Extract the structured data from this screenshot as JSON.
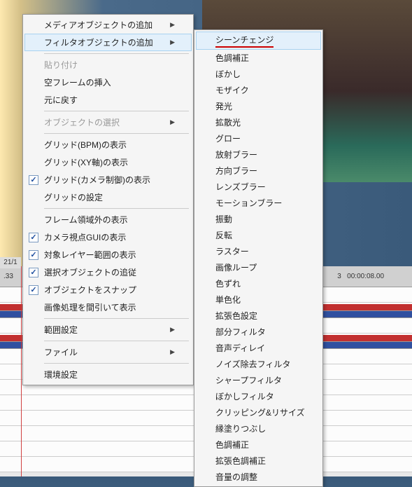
{
  "timeline": {
    "label_cell": "21/1",
    "timecode_left": ".33",
    "timecode_right_1": "3",
    "timecode_right_2": "00:00:08.00"
  },
  "menu": {
    "items": [
      {
        "label": "メディアオブジェクトの追加",
        "submenu": true,
        "disabled": false
      },
      {
        "label": "フィルタオブジェクトの追加",
        "submenu": true,
        "disabled": false,
        "highlighted": true
      },
      {
        "type": "separator"
      },
      {
        "label": "貼り付け",
        "disabled": true
      },
      {
        "label": "空フレームの挿入",
        "disabled": false
      },
      {
        "label": "元に戻す",
        "disabled": false
      },
      {
        "type": "separator"
      },
      {
        "label": "オブジェクトの選択",
        "submenu": true,
        "disabled": true
      },
      {
        "type": "separator"
      },
      {
        "label": "グリッド(BPM)の表示",
        "disabled": false
      },
      {
        "label": "グリッド(XY軸)の表示",
        "disabled": false
      },
      {
        "label": "グリッド(カメラ制御)の表示",
        "disabled": false,
        "checked": true
      },
      {
        "label": "グリッドの設定",
        "disabled": false
      },
      {
        "type": "separator"
      },
      {
        "label": "フレーム領域外の表示",
        "disabled": false
      },
      {
        "label": "カメラ視点GUIの表示",
        "disabled": false,
        "checked": true
      },
      {
        "label": "対象レイヤー範囲の表示",
        "disabled": false,
        "checked": true
      },
      {
        "label": "選択オブジェクトの追従",
        "disabled": false,
        "checked": true
      },
      {
        "label": "オブジェクトをスナップ",
        "disabled": false,
        "checked": true
      },
      {
        "label": "画像処理を間引いて表示",
        "disabled": false
      },
      {
        "type": "separator"
      },
      {
        "label": "範囲設定",
        "submenu": true,
        "disabled": false
      },
      {
        "type": "separator"
      },
      {
        "label": "ファイル",
        "submenu": true,
        "disabled": false
      },
      {
        "type": "separator"
      },
      {
        "label": "環境設定",
        "disabled": false
      }
    ]
  },
  "submenu": {
    "items": [
      {
        "label": "シーンチェンジ",
        "highlighted": true,
        "underlined": true
      },
      {
        "label": "色調補正"
      },
      {
        "label": "ぼかし"
      },
      {
        "label": "モザイク"
      },
      {
        "label": "発光"
      },
      {
        "label": "拡散光"
      },
      {
        "label": "グロー"
      },
      {
        "label": "放射ブラー"
      },
      {
        "label": "方向ブラー"
      },
      {
        "label": "レンズブラー"
      },
      {
        "label": "モーションブラー"
      },
      {
        "label": "振動"
      },
      {
        "label": "反転"
      },
      {
        "label": "ラスター"
      },
      {
        "label": "画像ループ"
      },
      {
        "label": "色ずれ"
      },
      {
        "label": "単色化"
      },
      {
        "label": "拡張色設定"
      },
      {
        "label": "部分フィルタ"
      },
      {
        "label": "音声ディレイ"
      },
      {
        "label": "ノイズ除去フィルタ"
      },
      {
        "label": "シャープフィルタ"
      },
      {
        "label": "ぼかしフィルタ"
      },
      {
        "label": "クリッピング&リサイズ"
      },
      {
        "label": "縁塗りつぶし"
      },
      {
        "label": "色調補正"
      },
      {
        "label": "拡張色調補正"
      },
      {
        "label": "音量の調整"
      }
    ]
  }
}
